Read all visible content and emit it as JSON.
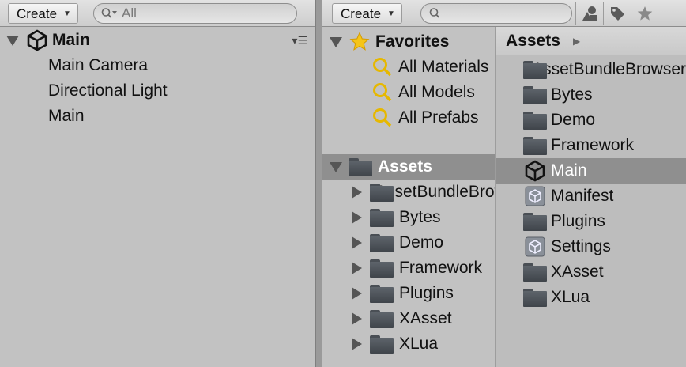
{
  "hierarchy": {
    "create_label": "Create",
    "search_placeholder": "All",
    "scene_name": "Main",
    "objects": [
      "Main Camera",
      "Directional Light",
      "Main"
    ]
  },
  "project": {
    "create_label": "Create",
    "search_placeholder": "",
    "favorites_label": "Favorites",
    "favorites": [
      "All Materials",
      "All Models",
      "All Prefabs"
    ],
    "assets_label": "Assets",
    "asset_folders": [
      "AssetBundleBrowser",
      "Bytes",
      "Demo",
      "Framework",
      "Plugins",
      "XAsset",
      "XLua"
    ],
    "breadcrumb": "Assets",
    "asset_items": [
      {
        "name": "AssetBundleBrowser",
        "type": "folder"
      },
      {
        "name": "Bytes",
        "type": "folder"
      },
      {
        "name": "Demo",
        "type": "folder"
      },
      {
        "name": "Framework",
        "type": "folder"
      },
      {
        "name": "Main",
        "type": "scene",
        "selected": true
      },
      {
        "name": "Manifest",
        "type": "asset"
      },
      {
        "name": "Plugins",
        "type": "folder"
      },
      {
        "name": "Settings",
        "type": "asset"
      },
      {
        "name": "XAsset",
        "type": "folder"
      },
      {
        "name": "XLua",
        "type": "folder"
      }
    ]
  },
  "colors": {
    "panel_bg": "#c2c2c2",
    "selection_bg": "#8f8f8f",
    "folder_icon": "#4d5359",
    "favorites_star": "#f5c518",
    "search_magnifier": "#e6b800"
  }
}
